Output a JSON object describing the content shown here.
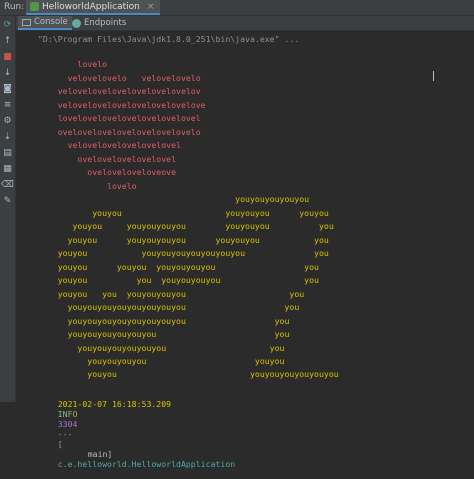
{
  "topbar": {
    "run_label": "Run:",
    "tab_label": "HelloworldApplication",
    "close_glyph": "×"
  },
  "subtabs": [
    {
      "label": "Console",
      "icon": "console-icon",
      "active": true
    },
    {
      "label": "Endpoints",
      "icon": "endpoints-icon",
      "active": false
    }
  ],
  "toolbar_icons": [
    "rerun-icon",
    "arrow-up-icon",
    "stop-icon",
    "arrow-down-icon",
    "camera-icon",
    "soft-wrap-icon",
    "settings-icon",
    "scroll-end-icon",
    "print-icon",
    "layout-icon",
    "clear-icon",
    "pin-icon"
  ],
  "console": {
    "command": "\"D:\\Program Files\\Java\\jdk1.8.0_251\\bin\\java.exe\" ...",
    "love_lines": [
      "        lovelo",
      "      velovelovelo   velovelovelo",
      "    velovelovelovelovelovelovelov",
      "    velovelovelovelovelovelovelove",
      "    lovelovelovelovelovelovelovel",
      "    ovelovelovelovelovelovelovelo",
      "      velovelovelovelovelovel",
      "        ovelovelovelovelovel",
      "          oveloveloveloveove",
      "              lovelo"
    ],
    "you_lines": [
      "                                        youyouyouyouyou",
      "           youyou                     youyouyou      youyou",
      "       youyou     youyouyouyou        youyouyou          you",
      "      youyou      youyouyouyou      youyouyou           you",
      "    youyou           youyouyouyouyouyouyou              you",
      "    youyou      youyou  youyouyouyou                  you",
      "    youyou          you  youyouyouyou                 you",
      "    youyou   you  youyouyouyou                     you",
      "      youyouyouyouyouyouyouyou                    you",
      "      youyouyouyouyouyouyouyou                  you",
      "      youyouyouyouyouyou                        you",
      "        youyouyouyouyouyou                     you",
      "          youyouyouyou                      youyou",
      "          youyou                           youyouyouyouyouyou",
      "          youyou                           youyouyouyouyouyou"
    ],
    "log": {
      "timestamp": "2021-02-07 16:18:53.209",
      "level": "INFO",
      "pid": "3304",
      "sep": "---",
      "bracket": "[",
      "thread": "main]",
      "class": "c.e.helloworld.HelloworldApplication"
    }
  },
  "colors": {
    "love": "#e05d68",
    "you": "#d8c400",
    "background": "#2b2b2b"
  }
}
